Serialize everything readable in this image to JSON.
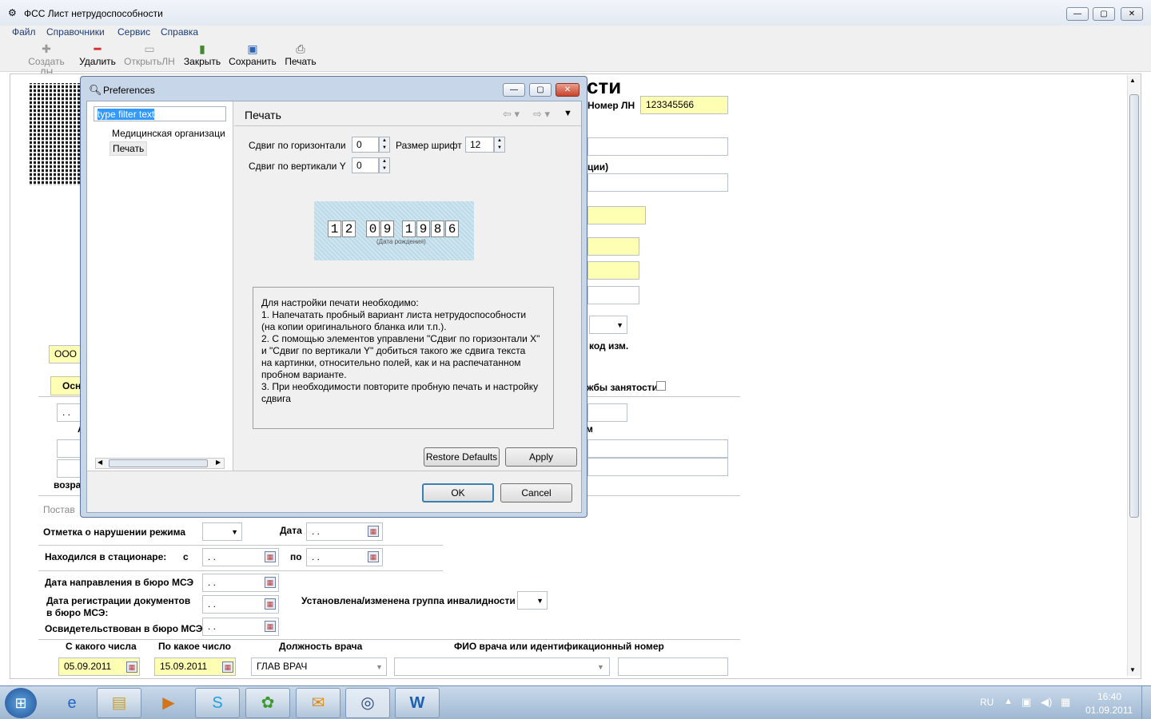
{
  "window": {
    "title": "ФСС Лист нетрудоспособности",
    "controls": {
      "minimize": "—",
      "maximize": "▢",
      "close": "✕"
    }
  },
  "menu": [
    "Файл",
    "Справочники",
    "Сервис",
    "Справка"
  ],
  "toolbar": {
    "create": "Создать ЛН",
    "delete": "Удалить",
    "open": "ОткрытьЛН",
    "close": "Закрыть",
    "save": "Сохранить",
    "print": "Печать"
  },
  "form": {
    "heading_fragment": "сти",
    "ln_number_label": "Номер ЛН",
    "ln_number_value": "123345566",
    "org_fragment_label": "ции)",
    "org_value_fragment": "ООО",
    "code_label": "код изм.",
    "tab_fragment": "Осн",
    "employment_label": "жбы занятости",
    "date_placeholder": ". .",
    "letter_a": "А",
    "letter_m": "м",
    "age_fragment": "возра",
    "section_fragment": "Постав",
    "violation_label": "Отметка о нарушении режима",
    "date_label": "Дата",
    "hospital_label": "Находился в стационаре:",
    "from_label": "с",
    "to_label": "по",
    "mse_direction_label": "Дата направления в бюро МСЭ",
    "mse_registration_label": "Дата регистрации документов\nв бюро МСЭ:",
    "mse_examined_label": "Освидетельствован в бюро МСЭ:",
    "disability_label": "Установлена/изменена группа инвалидности",
    "col_from": "С какого числа",
    "col_to": "По какое число",
    "col_position": "Должность врача",
    "col_doctor": "ФИО врача или идентификационный номер",
    "row_from": "05.09.2011",
    "row_to": "15.09.2011",
    "row_position": "ГЛАВ ВРАЧ"
  },
  "dialog": {
    "title": "Preferences",
    "filter_placeholder": "type filter text",
    "tree": [
      "Медицинская организаци",
      "Печать"
    ],
    "page_title": "Печать",
    "h_shift_label": "Сдвиг по горизонтали",
    "h_shift_value": "0",
    "font_size_label": "Размер шрифт",
    "font_size_value": "12",
    "v_shift_label": "Сдвиг по вертикали Y",
    "v_shift_value": "0",
    "sample_digits": [
      "1",
      "2",
      "0",
      "9",
      "1",
      "9",
      "8",
      "6"
    ],
    "sample_caption": "(Дата рождения)",
    "instructions": "Для настройки печати необходимо:\n1. Напечатать пробный вариант листа нетрудоспособности\n   (на копии оригинального бланка или т.п.).\n2. С помощью элементов управлени \"Сдвиг по горизонтали X\"\n   и \"Сдвиг по вертикали Y\" добиться такого же сдвига текста\n   на картинки, относительно полей, как и на распечатанном\n   пробном варианте.\n3. При необходимости повторите пробную печать и настройку\n   сдвига",
    "restore_defaults": "Restore Defaults",
    "apply": "Apply",
    "ok": "OK",
    "cancel": "Cancel"
  },
  "taskbar": {
    "lang": "RU",
    "time": "16:40",
    "date": "01.09.2011",
    "apps": [
      "windows-explorer-icon",
      "skype-icon",
      "icq-icon",
      "outlook-icon",
      "fss-app-icon",
      "word-icon"
    ]
  }
}
